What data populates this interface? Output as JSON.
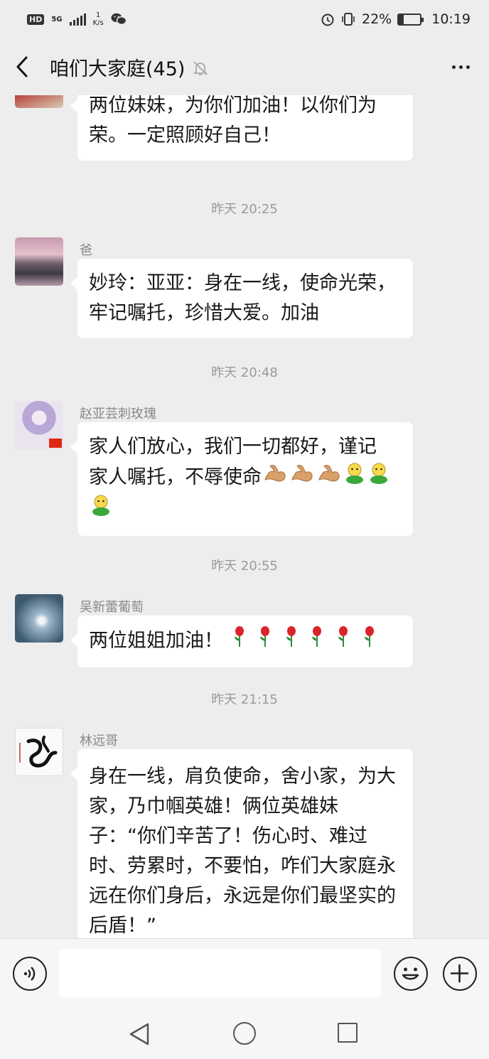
{
  "status_bar": {
    "hd_label": "HD",
    "network_type": "5G",
    "speed_value": "1",
    "speed_unit": "K/s",
    "battery_percent": "22%",
    "battery_level": 0.22,
    "time": "10:19"
  },
  "header": {
    "title": "咱们大家庭(45)",
    "back_icon": "chevron-left-icon",
    "muted_icon": "bell-off-icon",
    "more_icon": "ellipsis-icon"
  },
  "messages": [
    {
      "text": "两位妹妹，为你们加油！以你们为荣。一定照顾好自己！"
    },
    {
      "time": "昨天 20:25"
    },
    {
      "sender": "爸",
      "text": "妙玲：亚亚：身在一线，使命光荣，牢记嘱托，珍惜大爱。加油"
    },
    {
      "time": "昨天 20:48"
    },
    {
      "sender": "赵亚芸刺玫瑰",
      "text_line1": "家人们放心，我们一切都好，谨记",
      "text_line2": "家人嘱托，不辱使命",
      "emojis": [
        "muscle",
        "muscle",
        "muscle",
        "strong",
        "strong",
        "strong"
      ]
    },
    {
      "time": "昨天 20:55"
    },
    {
      "sender": "吴新蕾葡萄",
      "text": "两位姐姐加油！",
      "emojis": [
        "rose",
        "rose",
        "rose",
        "rose",
        "rose",
        "rose"
      ]
    },
    {
      "time": "昨天 21:15"
    },
    {
      "sender": "林远哥",
      "text": "身在一线，肩负使命，舍小家，为大家，乃巾帼英雄！俩位英雄妹子：“你们辛苦了！伤心时、难过时、劳累时，不要怕，咋们大家庭永远在你们身后，永远是你们最坚实的后盾！”"
    }
  ],
  "input_bar": {
    "voice_icon": "voice-icon",
    "emoji_icon": "smiley-icon",
    "plus_icon": "plus-icon",
    "placeholder": ""
  },
  "system_nav": {
    "back_icon": "triangle-back-icon",
    "home_icon": "circle-home-icon",
    "recent_icon": "square-recent-icon"
  }
}
